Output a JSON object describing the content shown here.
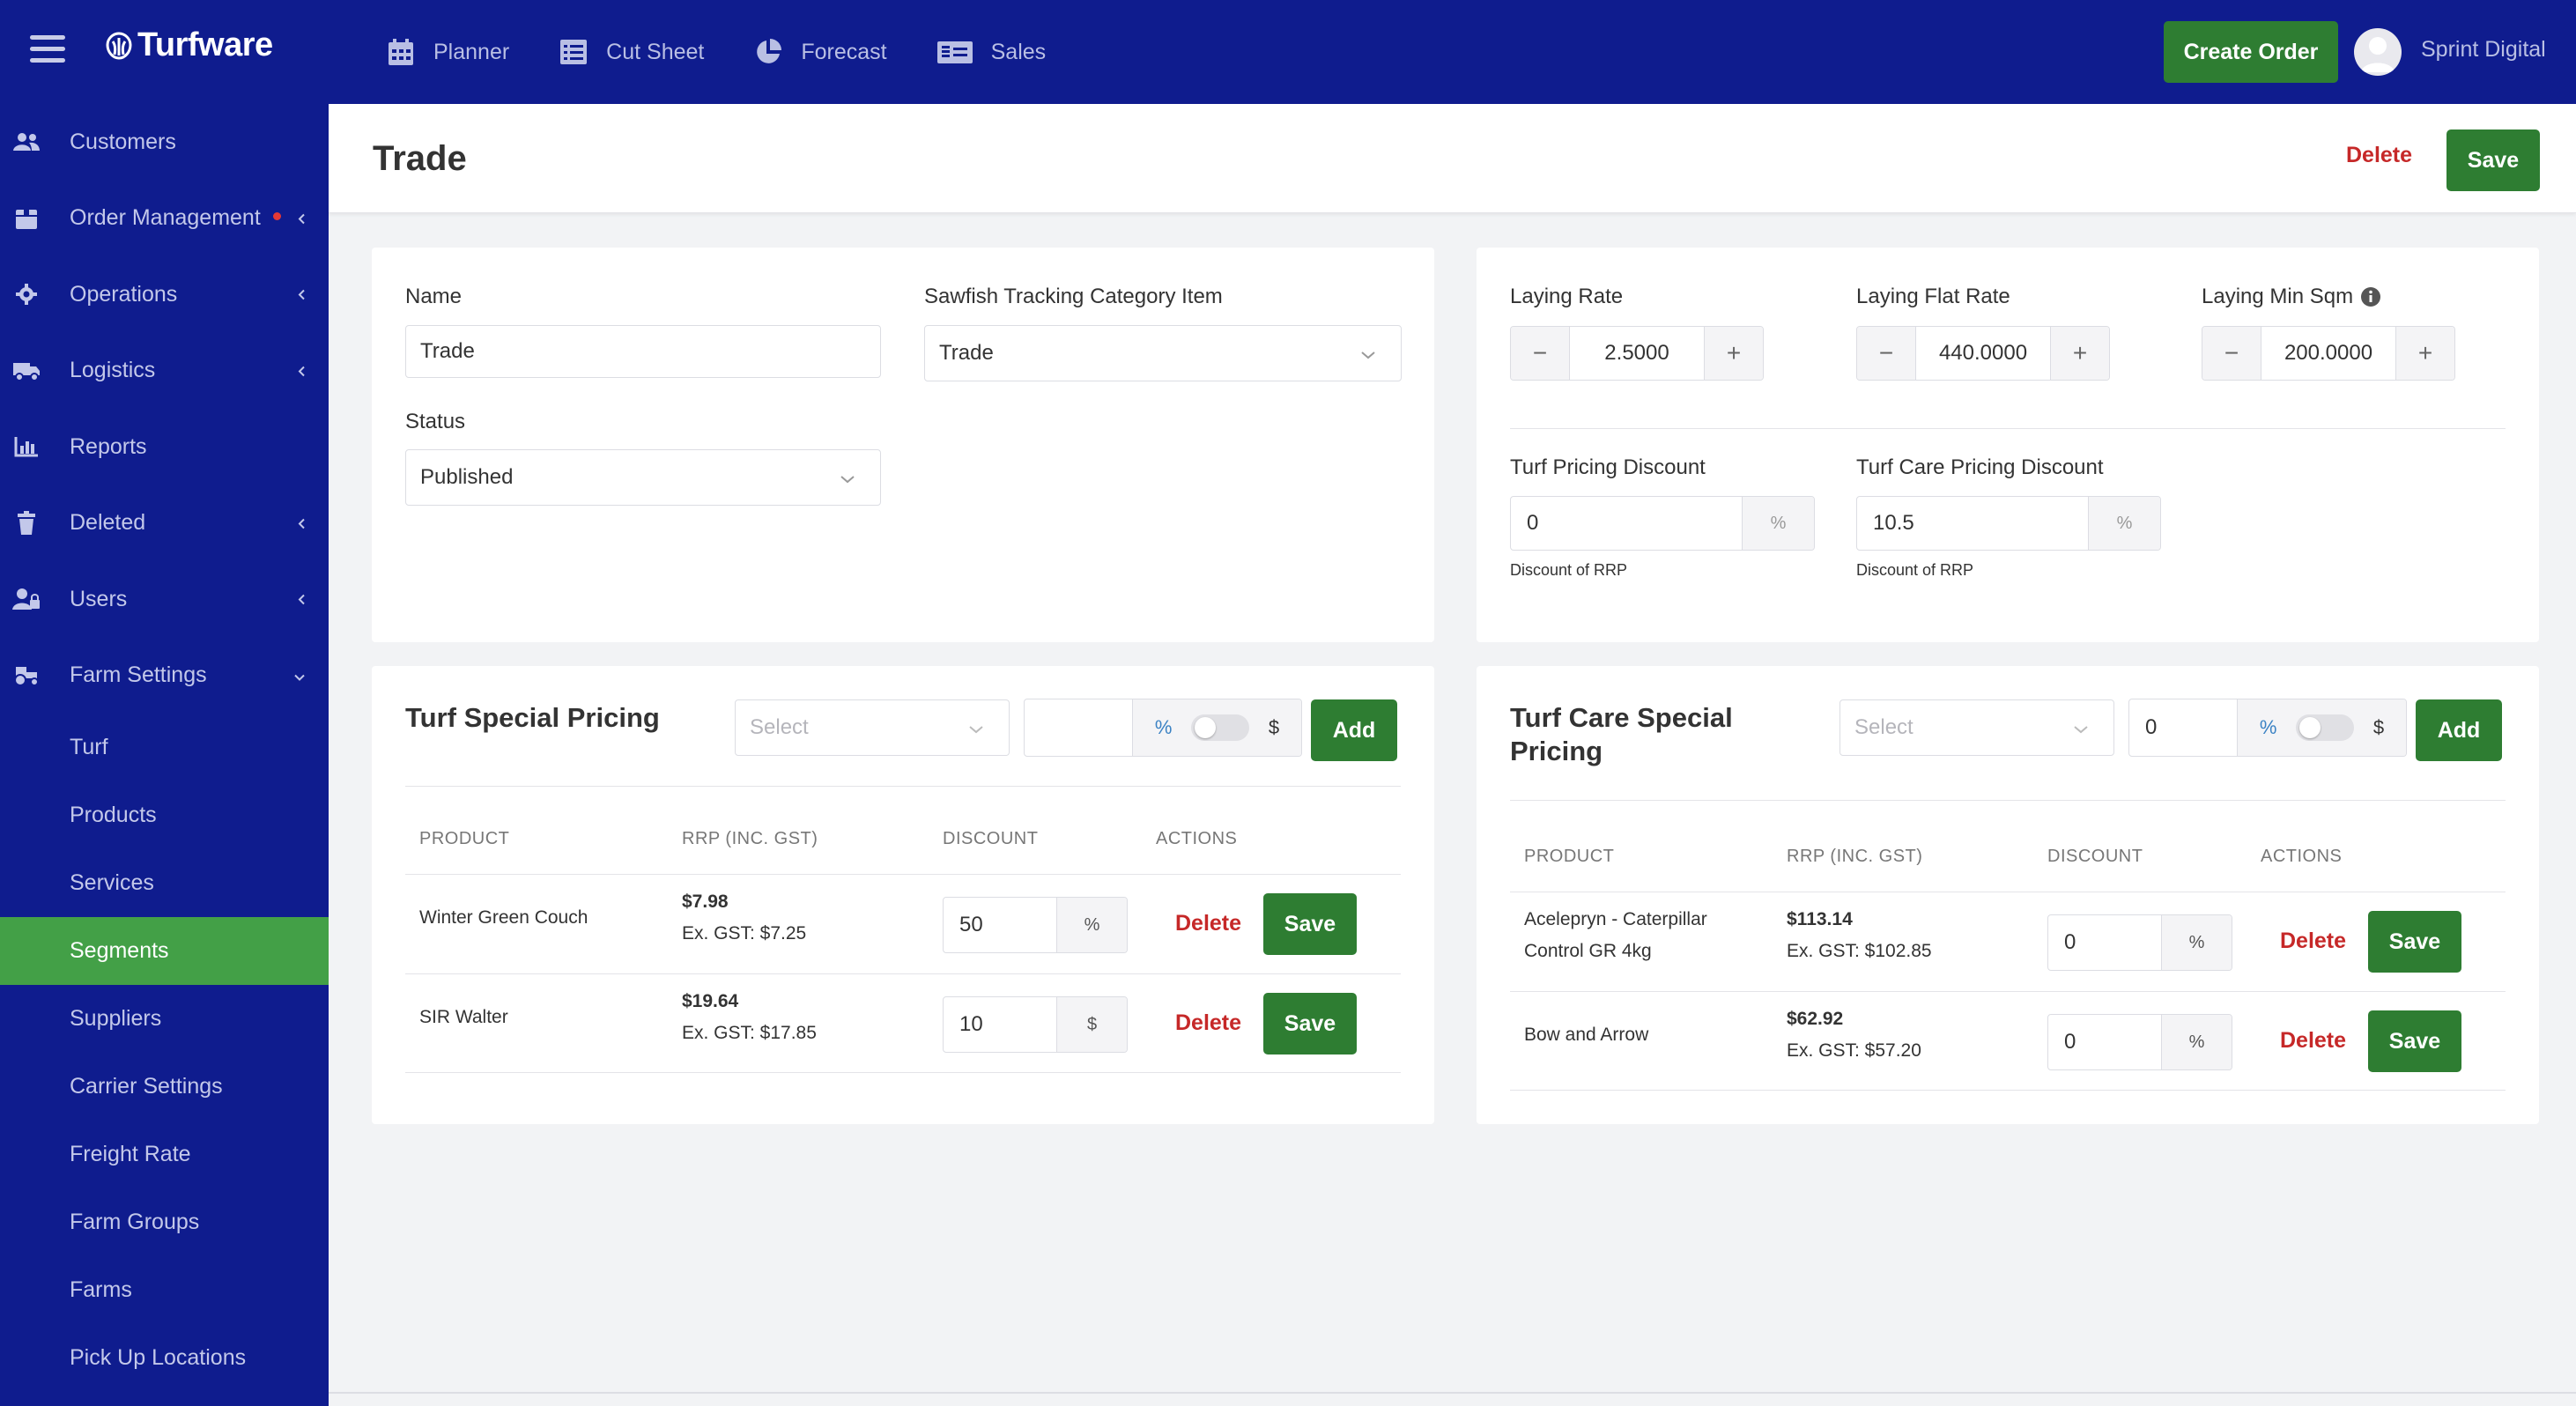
{
  "app": {
    "name": "Turfware"
  },
  "topnav": [
    {
      "label": "Planner",
      "icon": "calendar-icon"
    },
    {
      "label": "Cut Sheet",
      "icon": "list-icon"
    },
    {
      "label": "Forecast",
      "icon": "pie-chart-icon"
    },
    {
      "label": "Sales",
      "icon": "receipt-icon"
    }
  ],
  "header_actions": {
    "create_order": "Create Order",
    "user_name": "Sprint Digital"
  },
  "sidebar": {
    "items": [
      {
        "label": "Customers",
        "icon": "users-icon"
      },
      {
        "label": "Order Management",
        "icon": "box-icon",
        "has_alert": true
      },
      {
        "label": "Operations",
        "icon": "gear-icon"
      },
      {
        "label": "Logistics",
        "icon": "truck-icon"
      },
      {
        "label": "Reports",
        "icon": "bar-chart-icon"
      },
      {
        "label": "Deleted",
        "icon": "trash-icon"
      },
      {
        "label": "Users",
        "icon": "user-lock-icon"
      },
      {
        "label": "Farm Settings",
        "icon": "tractor-icon",
        "expanded": true
      }
    ],
    "sub_items": [
      "Turf",
      "Products",
      "Services",
      "Segments",
      "Suppliers",
      "Carrier Settings",
      "Freight Rate",
      "Farm Groups",
      "Farms",
      "Pick Up Locations"
    ],
    "active_sub": "Segments"
  },
  "page": {
    "title": "Trade",
    "delete_label": "Delete",
    "save_label": "Save"
  },
  "general": {
    "name_label": "Name",
    "name_value": "Trade",
    "tracking_label": "Sawfish Tracking Category Item",
    "tracking_value": "Trade",
    "status_label": "Status",
    "status_value": "Published"
  },
  "rates": {
    "laying_rate_label": "Laying Rate",
    "laying_rate": "2.5000",
    "laying_flat_label": "Laying Flat Rate",
    "laying_flat": "440.0000",
    "laying_min_label": "Laying Min Sqm",
    "laying_min": "200.0000",
    "turf_discount_label": "Turf Pricing Discount",
    "turf_discount": "0",
    "turf_care_discount_label": "Turf Care Pricing Discount",
    "turf_care_discount": "10.5",
    "unit_pct": "%",
    "hint": "Discount of RRP"
  },
  "turf_special": {
    "title": "Turf Special Pricing",
    "select_placeholder": "Select",
    "value": "",
    "pct": "%",
    "dollar": "$",
    "add_label": "Add",
    "columns": [
      "PRODUCT",
      "RRP (INC. GST)",
      "DISCOUNT",
      "ACTIONS"
    ],
    "rows": [
      {
        "product": "Winter Green Couch",
        "rrp": "$7.98",
        "ex_gst": "Ex. GST: $7.25",
        "discount": "50",
        "unit": "%",
        "delete": "Delete",
        "save": "Save"
      },
      {
        "product": "SIR Walter",
        "rrp": "$19.64",
        "ex_gst": "Ex. GST: $17.85",
        "discount": "10",
        "unit": "$",
        "delete": "Delete",
        "save": "Save"
      }
    ]
  },
  "turf_care_special": {
    "title_line1": "Turf Care Special",
    "title_line2": "Pricing",
    "select_placeholder": "Select",
    "value": "0",
    "pct": "%",
    "dollar": "$",
    "add_label": "Add",
    "columns": [
      "PRODUCT",
      "RRP (INC. GST)",
      "DISCOUNT",
      "ACTIONS"
    ],
    "rows": [
      {
        "product_line1": "Acelepryn - Caterpillar",
        "product_line2": "Control GR 4kg",
        "rrp": "$113.14",
        "ex_gst": "Ex. GST: $102.85",
        "discount": "0",
        "unit": "%",
        "delete": "Delete",
        "save": "Save"
      },
      {
        "product_line1": "Bow and Arrow",
        "product_line2": "",
        "rrp": "$62.92",
        "ex_gst": "Ex. GST: $57.20",
        "discount": "0",
        "unit": "%",
        "delete": "Delete",
        "save": "Save"
      }
    ]
  },
  "colors": {
    "nav_bg": "#0f1c8e",
    "accent_green": "#2e7d32",
    "active_green": "#43a047",
    "danger": "#c62828"
  }
}
